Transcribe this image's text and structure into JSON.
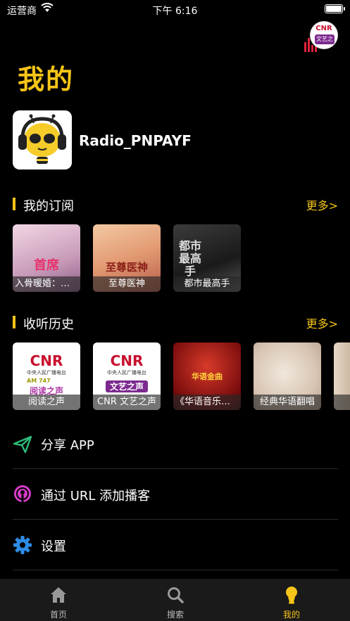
{
  "status_bar": {
    "carrier": "运营商",
    "time": "下午 6:16"
  },
  "now_playing": {
    "logo_text": "CNR",
    "art_text": "文艺之声"
  },
  "page_title": "我的",
  "profile": {
    "username": "Radio_PNPAYF"
  },
  "subscriptions": {
    "title": "我的订阅",
    "more": "更多>",
    "items": [
      {
        "label": "入骨暖婚：首…",
        "cover_text": "首席"
      },
      {
        "label": "至尊医神",
        "cover_text": "至尊医神"
      },
      {
        "label": "都市最高手",
        "cover_text": "都市最高手"
      }
    ]
  },
  "history": {
    "title": "收听历史",
    "more": "更多>",
    "items": [
      {
        "label": "阅读之声",
        "logo": "CNR",
        "sub": "中央人民广播电台",
        "fm": "AM 747",
        "art": "阅读之声"
      },
      {
        "label": "CNR 文艺之声",
        "logo": "CNR",
        "sub": "中央人民广播电台",
        "art": "文艺之声"
      },
      {
        "label": "《华语音乐排…",
        "art": "华语金曲"
      },
      {
        "label": "经典华语翻唱"
      }
    ]
  },
  "menu": [
    {
      "label": "分享 APP",
      "icon": "share-icon",
      "color": "#2ebd7a"
    },
    {
      "label": "通过 URL 添加播客",
      "icon": "podcast-icon",
      "color": "#d63cc8"
    },
    {
      "label": "设置",
      "icon": "gear-icon",
      "color": "#2d8ce6"
    }
  ],
  "tabs": [
    {
      "label": "首页",
      "icon": "home-icon"
    },
    {
      "label": "搜索",
      "icon": "search-icon"
    },
    {
      "label": "我的",
      "icon": "profile-icon",
      "active": true
    }
  ],
  "colors": {
    "accent": "#f5c518",
    "background": "#000000",
    "tabbar": "#1a1a1a"
  }
}
